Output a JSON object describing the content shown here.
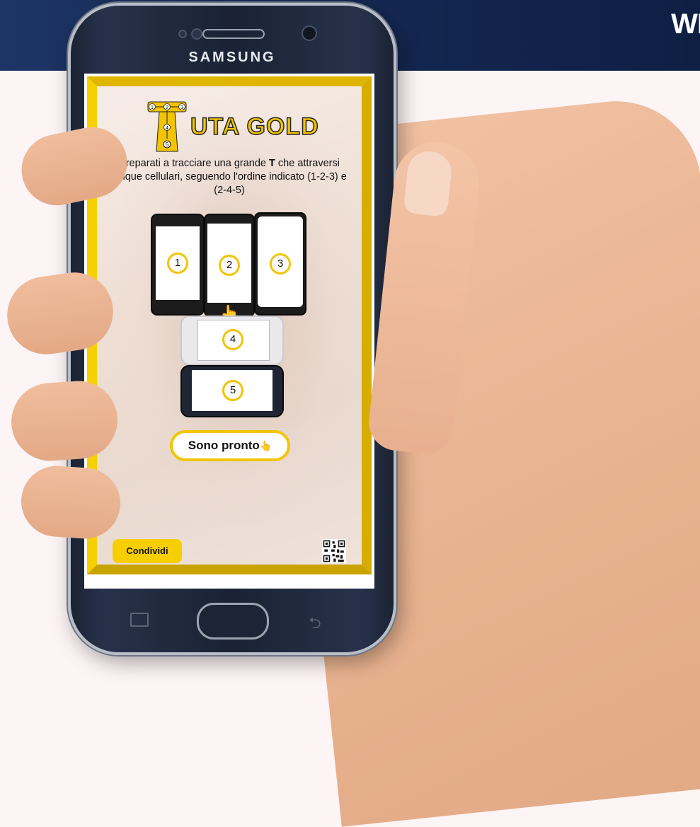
{
  "header": {
    "brand": "WI"
  },
  "device": {
    "manufacturer": "SAMSUNG"
  },
  "app": {
    "logo": {
      "title": "UTA GOLD",
      "steps_top": [
        "1",
        "2",
        "3"
      ],
      "steps_stem": [
        "4",
        "5"
      ]
    },
    "intro": {
      "line_before_bold": "Preparati a tracciare una grande ",
      "bold": "T",
      "line_after_bold": " che attraversi cinque cellulari, seguendo l'ordine indicato (1-2-3) e (2-4-5)"
    },
    "phones": [
      "1",
      "2",
      "3",
      "4",
      "5"
    ],
    "ready_button": "Sono pronto",
    "share_button": "Condividi"
  },
  "colors": {
    "accent_yellow": "#f2c500",
    "header_navy": "#13264f",
    "phone_body": "#1a2234"
  },
  "icons": {
    "pointer": "pointing-hand-icon",
    "qr": "qr-code-icon"
  }
}
